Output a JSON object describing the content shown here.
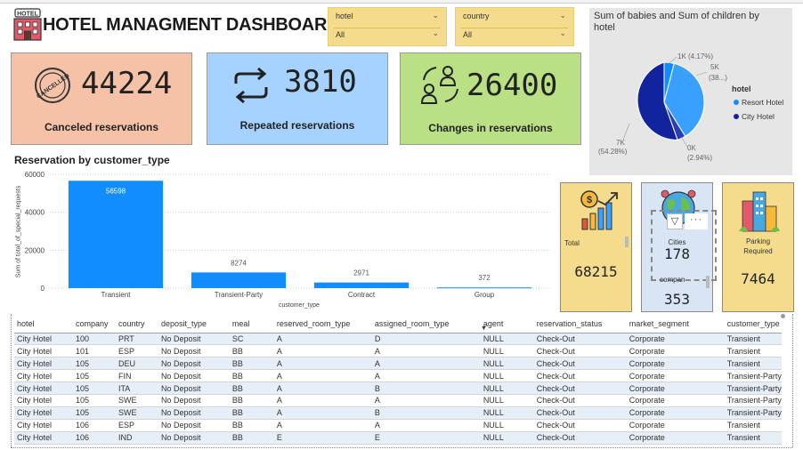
{
  "dashboard": {
    "title": "HOTEL MANAGMENT DASHBOARD",
    "logo_text": "HOTEL"
  },
  "slicers": [
    {
      "label": "hotel",
      "selected": "All"
    },
    {
      "label": "country",
      "selected": "All"
    }
  ],
  "cards": {
    "canceled": {
      "value": "44224",
      "caption": "Canceled reservations",
      "stamp": "CANCELLED"
    },
    "repeated": {
      "value": "3810",
      "caption": "Repeated reservations"
    },
    "changes": {
      "value": "26400",
      "caption": "Changes in reservations"
    }
  },
  "pie": {
    "title": "Sum of babies and Sum of children by hotel",
    "legend_title": "hotel",
    "labels": {
      "a_top": "1K (4.17%)",
      "b_top": "5K",
      "b_bottom": "(38...)",
      "c_left": "7K",
      "c_left_pct": "(54.28%)",
      "d_bottom": "0K",
      "d_bottom_pct": "(2.94%)"
    },
    "legend": [
      {
        "name": "Resort Hotel",
        "color": "#118dff"
      },
      {
        "name": "City Hotel",
        "color": "#12239e"
      }
    ]
  },
  "bar_chart": {
    "title": "Reservation by customer_type",
    "ylabel": "Sum of total_of_special_requests",
    "xlabel": "customer_type",
    "yticks": [
      "60000",
      "40000",
      "20000",
      "0"
    ],
    "labels": [
      "56598",
      "8274",
      "2971",
      "372"
    ]
  },
  "chart_data": {
    "type": "bar",
    "title": "Reservation by customer_type",
    "xlabel": "customer_type",
    "ylabel": "Sum of total_of_special_requests",
    "categories": [
      "Transient",
      "Transient-Party",
      "Contract",
      "Group"
    ],
    "values": [
      56598,
      8274,
      2971,
      372
    ],
    "ylim": [
      0,
      60000
    ],
    "grid": true,
    "color": "#118dff"
  },
  "kpis": {
    "total": {
      "label": "Total",
      "value": "68215"
    },
    "cities": {
      "label": "Cities",
      "value": "178",
      "sub_label": "compan",
      "sub_value": "353"
    },
    "parking": {
      "label": "Parking Required",
      "value": "7464"
    }
  },
  "table": {
    "columns": [
      "hotel",
      "company",
      "country",
      "deposit_type",
      "meal",
      "reserved_room_type",
      "assigned_room_type",
      "agent",
      "reservation_status",
      "market_segment",
      "customer_type"
    ],
    "rows": [
      [
        "City Hotel",
        "100",
        "PRT",
        "No Deposit",
        "SC",
        "A",
        "D",
        "NULL",
        "Check-Out",
        "Corporate",
        "Transient"
      ],
      [
        "City Hotel",
        "101",
        "ESP",
        "No Deposit",
        "BB",
        "A",
        "A",
        "NULL",
        "Check-Out",
        "Corporate",
        "Transient"
      ],
      [
        "City Hotel",
        "105",
        "DEU",
        "No Deposit",
        "BB",
        "A",
        "A",
        "NULL",
        "Check-Out",
        "Corporate",
        "Transient"
      ],
      [
        "City Hotel",
        "105",
        "FIN",
        "No Deposit",
        "BB",
        "A",
        "A",
        "NULL",
        "Check-Out",
        "Corporate",
        "Transient-Party"
      ],
      [
        "City Hotel",
        "105",
        "ITA",
        "No Deposit",
        "BB",
        "A",
        "B",
        "NULL",
        "Check-Out",
        "Corporate",
        "Transient-Party"
      ],
      [
        "City Hotel",
        "105",
        "SWE",
        "No Deposit",
        "BB",
        "A",
        "A",
        "NULL",
        "Check-Out",
        "Corporate",
        "Transient-Party"
      ],
      [
        "City Hotel",
        "105",
        "SWE",
        "No Deposit",
        "BB",
        "A",
        "B",
        "NULL",
        "Check-Out",
        "Corporate",
        "Transient-Party"
      ],
      [
        "City Hotel",
        "106",
        "ESP",
        "No Deposit",
        "BB",
        "A",
        "A",
        "NULL",
        "Check-Out",
        "Corporate",
        "Transient"
      ],
      [
        "City Hotel",
        "106",
        "IND",
        "No Deposit",
        "BB",
        "E",
        "E",
        "NULL",
        "Check-Out",
        "Corporate",
        "Transient"
      ]
    ]
  }
}
